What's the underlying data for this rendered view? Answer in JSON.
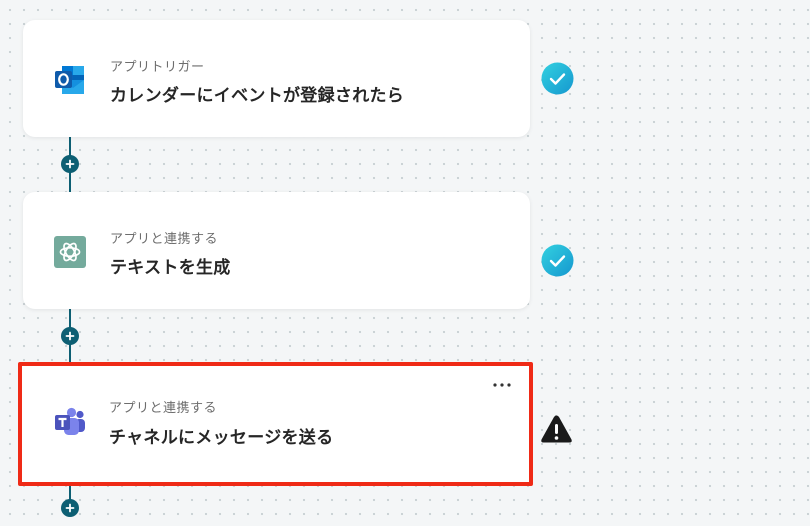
{
  "colors": {
    "connector": "#0d5f73",
    "success": "#20b8d6",
    "warning": "#1a1a1a",
    "highlight_border": "#ef2a16"
  },
  "steps": [
    {
      "label": "アプリトリガー",
      "title": "カレンダーにイベントが登録されたら",
      "app_icon": "outlook-icon",
      "status": "success-check-icon"
    },
    {
      "label": "アプリと連携する",
      "title": "テキストを生成",
      "app_icon": "chatgpt-icon",
      "status": "success-check-icon"
    },
    {
      "label": "アプリと連携する",
      "title": "チャネルにメッセージを送る",
      "app_icon": "teams-icon",
      "status": "warning-icon",
      "menu_icon": "more-options-icon"
    }
  ]
}
